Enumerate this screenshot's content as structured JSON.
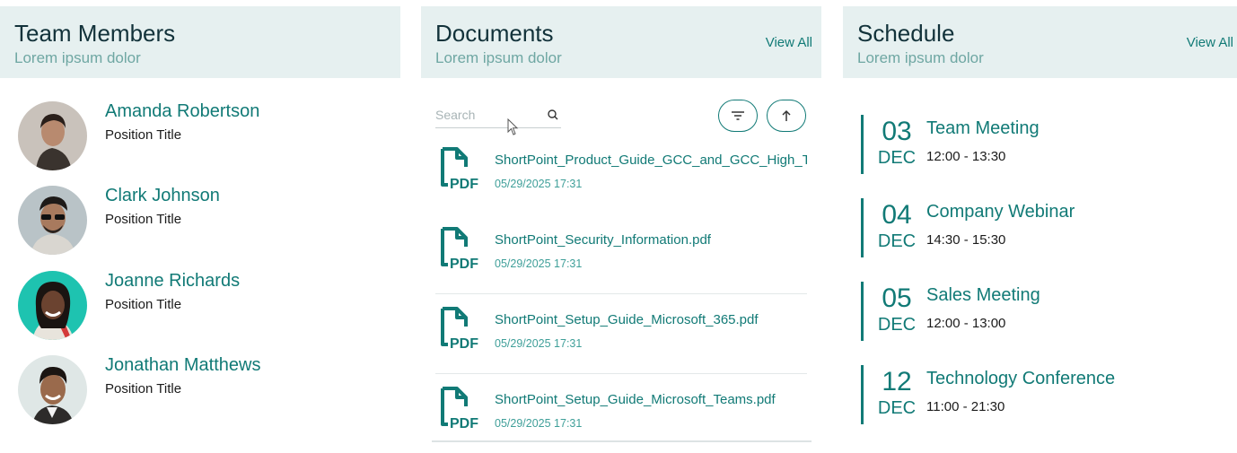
{
  "team": {
    "title": "Team Members",
    "subtitle": "Lorem ipsum dolor",
    "members": [
      {
        "name": "Amanda Robertson",
        "position": "Position Title"
      },
      {
        "name": "Clark Johnson",
        "position": "Position Title"
      },
      {
        "name": "Joanne Richards",
        "position": "Position Title"
      },
      {
        "name": "Jonathan Matthews",
        "position": "Position Title"
      }
    ]
  },
  "documents": {
    "title": "Documents",
    "subtitle": "Lorem ipsum dolor",
    "view_all": "View All",
    "search_placeholder": "Search",
    "files": [
      {
        "name": "ShortPoint_Product_Guide_GCC_and_GCC_High_Tenants.pdf",
        "date": "05/29/2025 17:31",
        "icon_label": "PDF"
      },
      {
        "name": "ShortPoint_Security_Information.pdf",
        "date": "05/29/2025 17:31",
        "icon_label": "PDF"
      },
      {
        "name": "ShortPoint_Setup_Guide_Microsoft_365.pdf",
        "date": "05/29/2025 17:31",
        "icon_label": "PDF"
      },
      {
        "name": "ShortPoint_Setup_Guide_Microsoft_Teams.pdf",
        "date": "05/29/2025 17:31",
        "icon_label": "PDF"
      }
    ]
  },
  "schedule": {
    "title": "Schedule",
    "subtitle": "Lorem ipsum dolor",
    "view_all": "View All",
    "events": [
      {
        "day": "03",
        "month": "DEC",
        "title": "Team Meeting",
        "time": "12:00 - 13:30"
      },
      {
        "day": "04",
        "month": "DEC",
        "title": "Company Webinar",
        "time": "14:30 - 15:30"
      },
      {
        "day": "05",
        "month": "DEC",
        "title": "Sales Meeting",
        "time": "12:00 - 13:00"
      },
      {
        "day": "12",
        "month": "DEC",
        "title": "Technology Conference",
        "time": "11:00 - 21:30"
      }
    ]
  },
  "colors": {
    "accent": "#117a76",
    "header_bg": "#e6f0f0",
    "subtitle": "#6fa7a3"
  }
}
